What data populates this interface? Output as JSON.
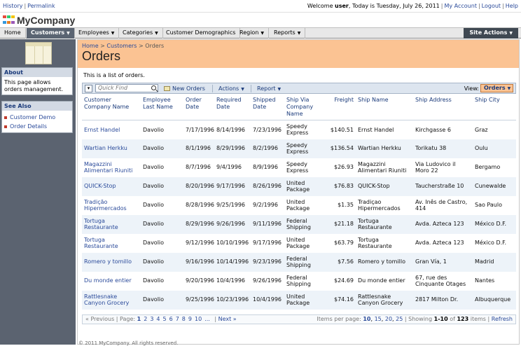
{
  "top": {
    "links_left": [
      "History",
      "Permalink"
    ],
    "welcome_prefix": "Welcome ",
    "user": "user",
    "welcome_suffix": ", Today is Tuesday, July 26, 2011",
    "links_right": [
      "My Account",
      "Logout",
      "Help"
    ]
  },
  "logo": {
    "name": "MyCompany",
    "colors": [
      "#e74c3c",
      "#2ecc71",
      "#f1c40f",
      "#3498db",
      "#e67e22",
      "#9b59b6"
    ]
  },
  "nav": {
    "tabs": [
      "Home",
      "Customers",
      "Employees",
      "Categories",
      "Customer Demographics",
      "Region",
      "Reports"
    ],
    "active": "Customers",
    "site_actions": "Site Actions"
  },
  "sidebar": {
    "about_title": "About",
    "about_text": "This page allows orders management.",
    "see_also_title": "See Also",
    "see_also": [
      "Customer Demo",
      "Order Details"
    ]
  },
  "page": {
    "breadcrumb": [
      "Home",
      "Customers",
      "Orders"
    ],
    "title": "Orders",
    "description": "This is a list of orders."
  },
  "toolbar": {
    "quick_find": "Quick Find",
    "new_orders": "New Orders",
    "actions": "Actions",
    "report": "Report",
    "view_label": "View:",
    "view_value": "Orders"
  },
  "table": {
    "columns": [
      "Customer Company Name",
      "Employee Last Name",
      "Order Date",
      "Required Date",
      "Shipped Date",
      "Ship Via Company Name",
      "Freight",
      "Ship Name",
      "Ship Address",
      "Ship City"
    ],
    "rows": [
      [
        "Ernst Handel",
        "Davolio",
        "7/17/1996",
        "8/14/1996",
        "7/23/1996",
        "Speedy Express",
        "$140.51",
        "Ernst Handel",
        "Kirchgasse 6",
        "Graz"
      ],
      [
        "Wartian Herkku",
        "Davolio",
        "8/1/1996",
        "8/29/1996",
        "8/2/1996",
        "Speedy Express",
        "$136.54",
        "Wartian Herkku",
        "Torikatu 38",
        "Oulu"
      ],
      [
        "Magazzini Alimentari Riuniti",
        "Davolio",
        "8/7/1996",
        "9/4/1996",
        "8/9/1996",
        "Speedy Express",
        "$26.93",
        "Magazzini Alimentari Riuniti",
        "Via Ludovico il Moro 22",
        "Bergamo"
      ],
      [
        "QUICK-Stop",
        "Davolio",
        "8/20/1996",
        "9/17/1996",
        "8/26/1996",
        "United Package",
        "$76.83",
        "QUICK-Stop",
        "Taucherstraße 10",
        "Cunewalde"
      ],
      [
        "Tradição Hipermercados",
        "Davolio",
        "8/28/1996",
        "9/25/1996",
        "9/2/1996",
        "United Package",
        "$1.35",
        "Tradiçao Hipermercados",
        "Av. Inês de Castro, 414",
        "Sao Paulo"
      ],
      [
        "Tortuga Restaurante",
        "Davolio",
        "8/29/1996",
        "9/26/1996",
        "9/11/1996",
        "Federal Shipping",
        "$21.18",
        "Tortuga Restaurante",
        "Avda. Azteca 123",
        "México D.F."
      ],
      [
        "Tortuga Restaurante",
        "Davolio",
        "9/12/1996",
        "10/10/1996",
        "9/17/1996",
        "United Package",
        "$63.79",
        "Tortuga Restaurante",
        "Avda. Azteca 123",
        "México D.F."
      ],
      [
        "Romero y tomillo",
        "Davolio",
        "9/16/1996",
        "10/14/1996",
        "9/23/1996",
        "Federal Shipping",
        "$7.56",
        "Romero y tomillo",
        "Gran Vía, 1",
        "Madrid"
      ],
      [
        "Du monde entier",
        "Davolio",
        "9/20/1996",
        "10/4/1996",
        "9/26/1996",
        "Federal Shipping",
        "$24.69",
        "Du monde entier",
        "67, rue des Cinquante Otages",
        "Nantes"
      ],
      [
        "Rattlesnake Canyon Grocery",
        "Davolio",
        "9/25/1996",
        "10/23/1996",
        "10/4/1996",
        "United Package",
        "$74.16",
        "Rattlesnake Canyon Grocery",
        "2817 Milton Dr.",
        "Albuquerque"
      ]
    ]
  },
  "pager": {
    "previous": "« Previous",
    "page_label": "Page:",
    "pages": [
      "1",
      "2",
      "3",
      "4",
      "5",
      "6",
      "7",
      "8",
      "9",
      "10",
      "..."
    ],
    "next": "Next »",
    "items_per_page_label": "Items per page:",
    "sizes": [
      "10",
      "15",
      "20",
      "25"
    ],
    "showing": "Showing",
    "range": "1-10",
    "of": "of",
    "total": "123",
    "items": "items",
    "refresh": "Refresh"
  },
  "footer": "© 2011 MyCompany. All rights reserved."
}
